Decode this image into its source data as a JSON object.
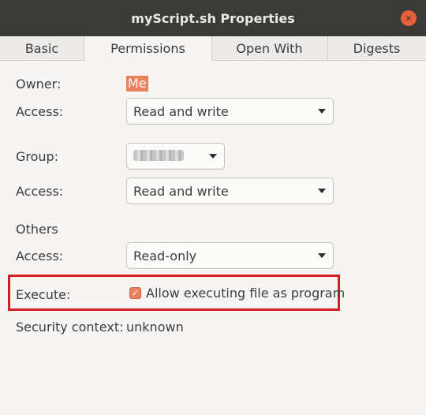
{
  "window": {
    "title": "myScript.sh Properties",
    "close_glyph": "✕"
  },
  "tabs": [
    {
      "label": "Basic"
    },
    {
      "label": "Permissions"
    },
    {
      "label": "Open With"
    },
    {
      "label": "Digests"
    }
  ],
  "active_tab": "Permissions",
  "owner": {
    "label": "Owner:",
    "value": "Me"
  },
  "owner_access": {
    "label": "Access:",
    "value": "Read and write"
  },
  "group": {
    "label": "Group:",
    "value_obscured": true
  },
  "group_access": {
    "label": "Access:",
    "value": "Read and write"
  },
  "others": {
    "heading": "Others"
  },
  "others_access": {
    "label": "Access:",
    "value": "Read-only"
  },
  "execute": {
    "label": "Execute:",
    "checkbox_label": "Allow executing file as program",
    "checked": true,
    "check_glyph": "✓"
  },
  "security": {
    "label": "Security context:",
    "value": "unknown"
  },
  "colors": {
    "accent": "#e9815c",
    "highlight_border": "#d81b23",
    "titlebar": "#3a3a37"
  }
}
